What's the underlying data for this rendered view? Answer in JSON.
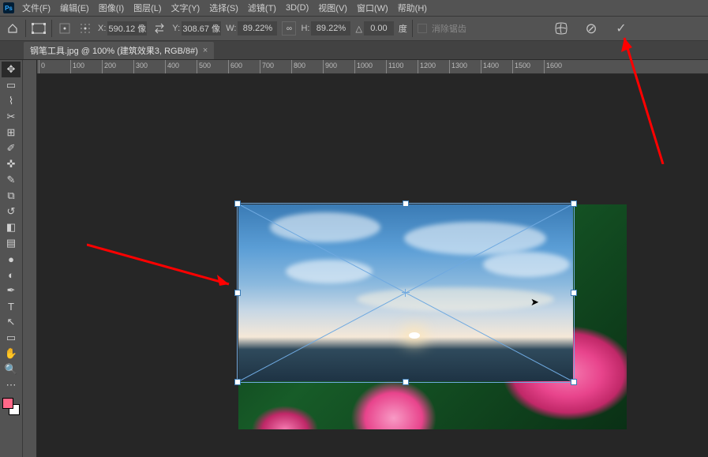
{
  "app": {
    "logo_text": "Ps"
  },
  "menu": {
    "items": [
      "文件(F)",
      "编辑(E)",
      "图像(I)",
      "图层(L)",
      "文字(Y)",
      "选择(S)",
      "滤镜(T)",
      "3D(D)",
      "视图(V)",
      "窗口(W)",
      "帮助(H)"
    ]
  },
  "options": {
    "x_label": "X:",
    "x_value": "590.12 像",
    "y_label": "Y:",
    "y_value": "308.67 像",
    "w_label": "W:",
    "w_value": "89.22%",
    "link_glyph": "∞",
    "h_label": "H:",
    "h_value": "89.22%",
    "angle_label": "△",
    "angle_value": "0.00",
    "deg_label": "度",
    "clear_label": "消除锯齿",
    "cancel_glyph": "⊘",
    "confirm_glyph": "✓"
  },
  "tab": {
    "title": "钢笔工具.jpg @ 100% (建筑效果3, RGB/8#)",
    "close": "×"
  },
  "ruler": {
    "h_ticks": [
      "700",
      "800",
      "900",
      "0",
      "100",
      "200",
      "300",
      "400",
      "500",
      "600",
      "700",
      "800",
      "900",
      "1000",
      "1100",
      "1200",
      "1300",
      "1400",
      "1500",
      "1600"
    ]
  },
  "tools": {
    "items": [
      {
        "name": "move-tool",
        "glyph": "✥"
      },
      {
        "name": "marquee-tool",
        "glyph": "▭"
      },
      {
        "name": "lasso-tool",
        "glyph": "⌇"
      },
      {
        "name": "crop-tool",
        "glyph": "✂"
      },
      {
        "name": "frame-tool",
        "glyph": "⊞"
      },
      {
        "name": "eyedropper-tool",
        "glyph": "✐"
      },
      {
        "name": "spot-heal-tool",
        "glyph": "✜"
      },
      {
        "name": "brush-tool",
        "glyph": "✎"
      },
      {
        "name": "clone-tool",
        "glyph": "⧉"
      },
      {
        "name": "history-brush-tool",
        "glyph": "↺"
      },
      {
        "name": "eraser-tool",
        "glyph": "◧"
      },
      {
        "name": "gradient-tool",
        "glyph": "▤"
      },
      {
        "name": "blur-tool",
        "glyph": "●"
      },
      {
        "name": "dodge-tool",
        "glyph": "◐"
      },
      {
        "name": "pen-tool",
        "glyph": "✒"
      },
      {
        "name": "type-tool",
        "glyph": "T"
      },
      {
        "name": "path-select-tool",
        "glyph": "↖"
      },
      {
        "name": "shape-tool",
        "glyph": "▭"
      },
      {
        "name": "hand-tool",
        "glyph": "✋"
      },
      {
        "name": "zoom-tool",
        "glyph": "🔍"
      },
      {
        "name": "more-tools",
        "glyph": "⋯"
      }
    ]
  },
  "annotations": {
    "arrow1_target": "transform-box-left-handle",
    "arrow2_target": "confirm-button"
  }
}
